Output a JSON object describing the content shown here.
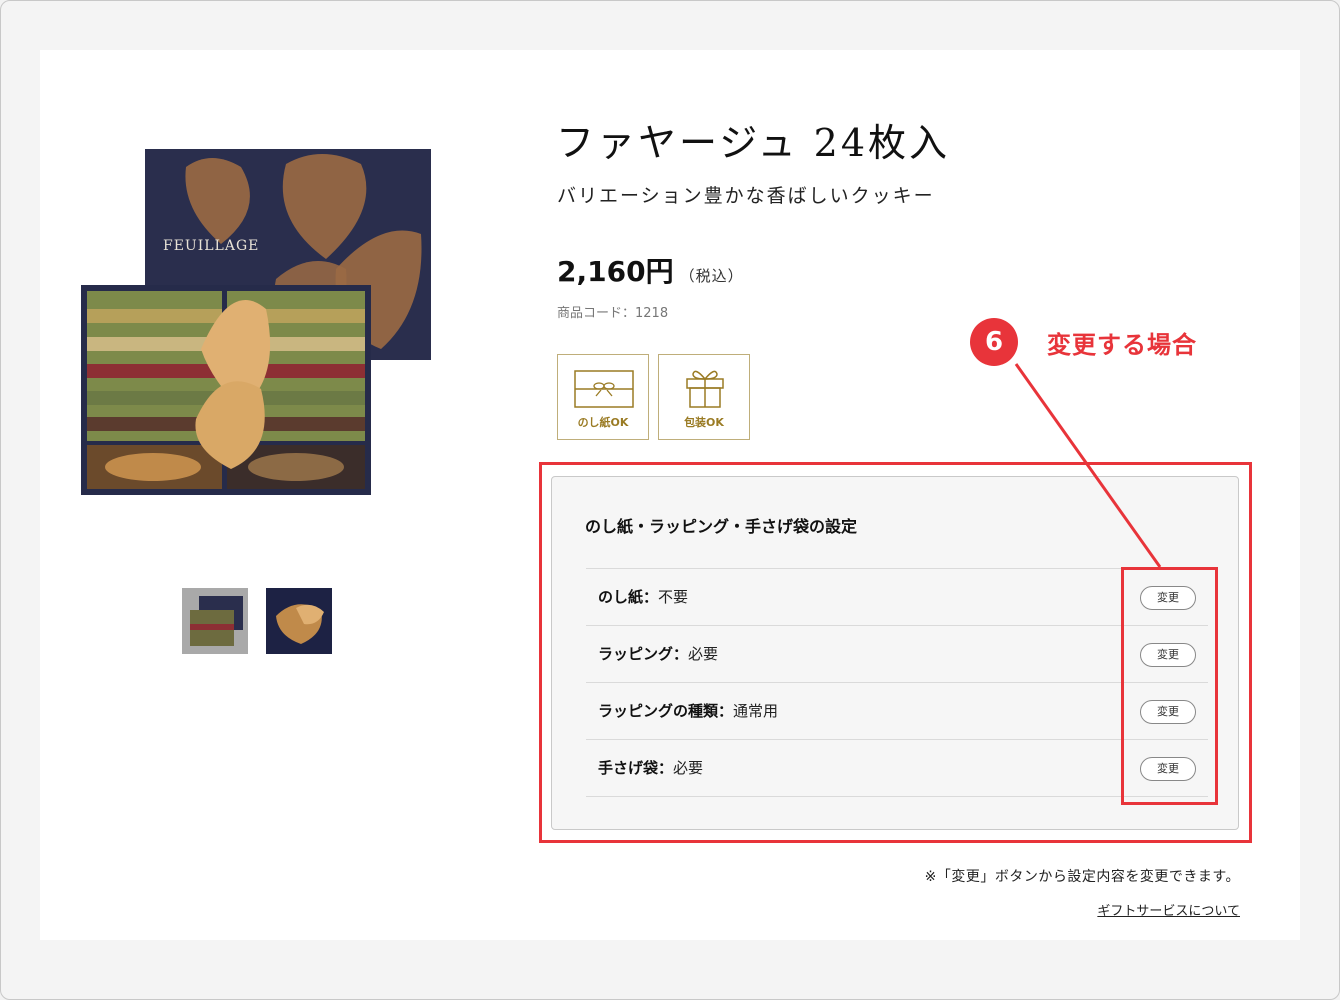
{
  "product": {
    "title": "ファヤージュ 24枚入",
    "subtitle": "バリエーション豊かな香ばしいクッキー",
    "price": "2,160円",
    "tax_note": "（税込）",
    "code": "商品コード：1218",
    "image_brand": "FEUILLAGE"
  },
  "badges": [
    {
      "label": "のし紙OK",
      "icon": "noshi-envelope-icon"
    },
    {
      "label": "包装OK",
      "icon": "gift-box-icon"
    }
  ],
  "gift_settings": {
    "title": "のし紙・ラッピング・手さげ袋の設定",
    "change_label": "変更",
    "rows": [
      {
        "label": "のし紙：",
        "value": "不要"
      },
      {
        "label": "ラッピング：",
        "value": "必要"
      },
      {
        "label": "ラッピングの種類：",
        "value": "通常用"
      },
      {
        "label": "手さげ袋：",
        "value": "必要"
      }
    ]
  },
  "note": "※「変更」ボタンから設定内容を変更できます。",
  "gift_service_link": "ギフトサービスについて",
  "annotation": {
    "step_number": "6",
    "step_label": "変更する場合",
    "color": "#e8343a"
  },
  "colors": {
    "badge_gold": "#9a7b24",
    "panel_bg": "#f6f6f6"
  }
}
